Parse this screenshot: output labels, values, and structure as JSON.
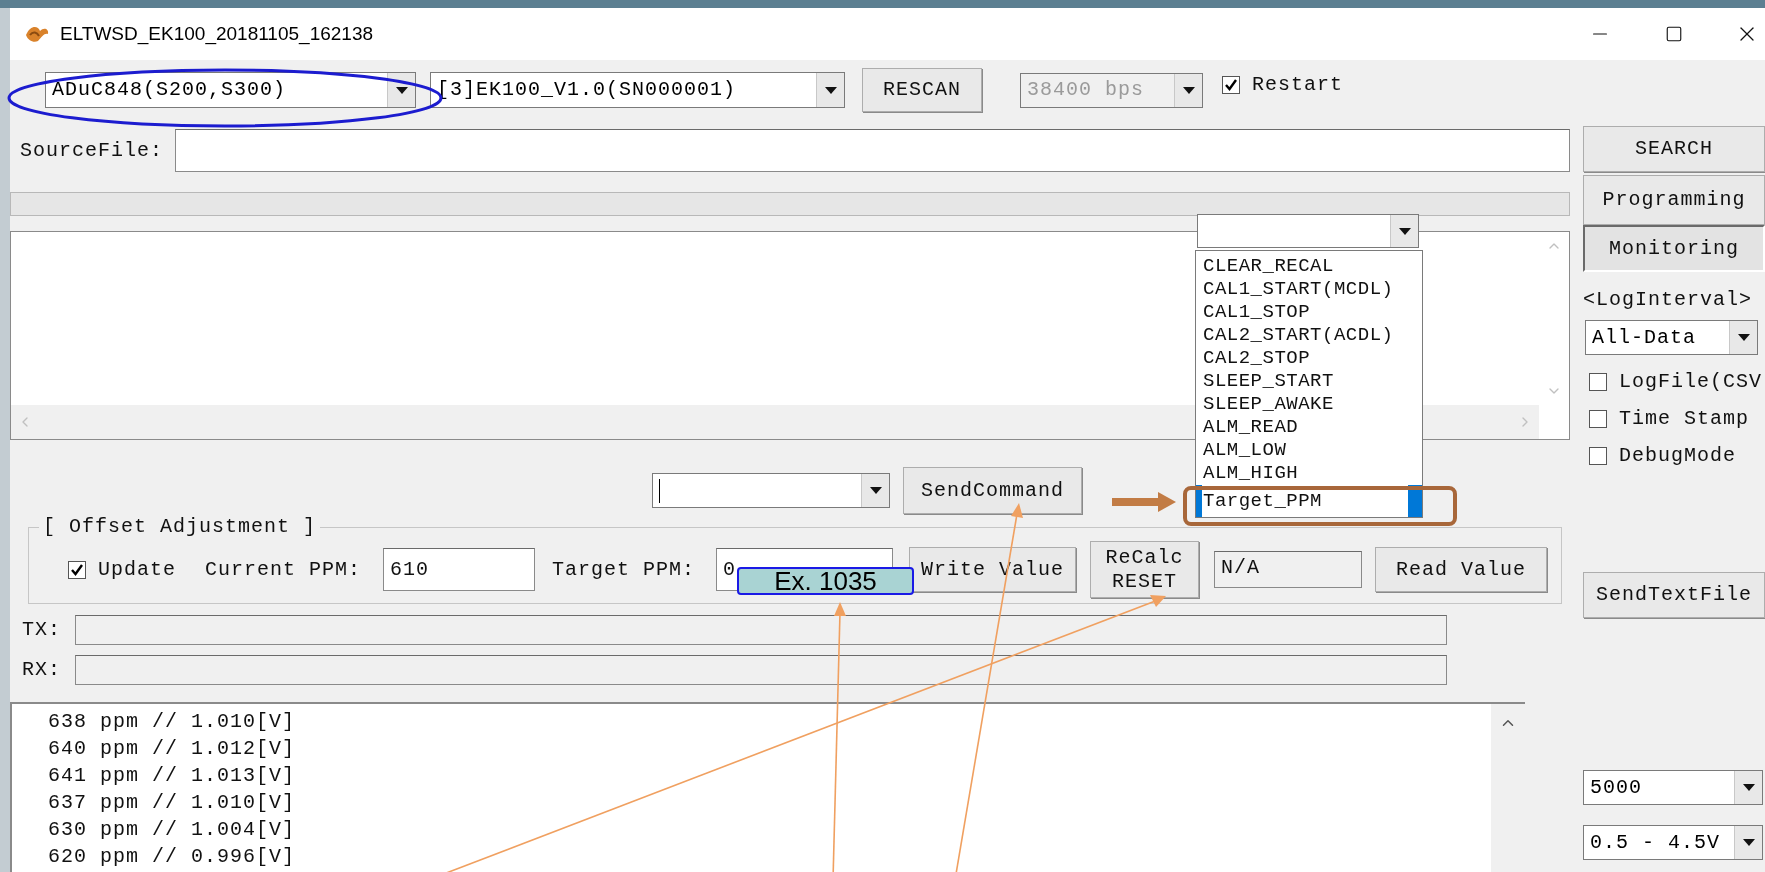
{
  "window": {
    "title": "ELTWSD_EK100_20181105_162138"
  },
  "toolbar": {
    "chip_select": {
      "value": "ADuC848(S200,S300)"
    },
    "device_select": {
      "value": "[3]EK100_V1.0(SN000001)"
    },
    "rescan_button": "RESCAN",
    "baud_select": {
      "value": "38400 bps",
      "disabled": true
    },
    "restart": {
      "label": "Restart",
      "checked": true
    }
  },
  "source_file": {
    "label": "SourceFile:"
  },
  "progress": {
    "level": 0
  },
  "command_menu": {
    "items": [
      {
        "label": "CLEAR_RECAL",
        "selected": false
      },
      {
        "label": "CAL1_START(MCDL)",
        "selected": false
      },
      {
        "label": "CAL1_STOP",
        "selected": false
      },
      {
        "label": "CAL2_START(ACDL)",
        "selected": false
      },
      {
        "label": "CAL2_STOP",
        "selected": false
      },
      {
        "label": "SLEEP_START",
        "selected": false
      },
      {
        "label": "SLEEP_AWAKE",
        "selected": false
      },
      {
        "label": "ALM_READ",
        "selected": false
      },
      {
        "label": "ALM_LOW",
        "selected": false
      },
      {
        "label": "ALM_HIGH",
        "selected": false
      },
      {
        "label": "Target_PPM",
        "selected": true
      }
    ]
  },
  "send_command": {
    "button": "SendCommand"
  },
  "offset": {
    "title": "[ Offset Adjustment ]",
    "update": {
      "label": "Update",
      "checked": true
    },
    "current_label": "Current PPM:",
    "current_value": "610",
    "target_label": "Target PPM:",
    "target_value": "0",
    "write_button": "Write Value",
    "recalc_button": [
      "ReCalc",
      "RESET"
    ],
    "readout": "N/A",
    "read_button": "Read Value"
  },
  "tx": {
    "label": "TX:"
  },
  "rx": {
    "label": "RX:"
  },
  "log_lines": [
    "638 ppm // 1.010[V]",
    "640 ppm // 1.012[V]",
    "641 ppm // 1.013[V]",
    "637 ppm // 1.010[V]",
    "630 ppm // 1.004[V]",
    "620 ppm // 0.996[V]"
  ],
  "side": {
    "buttons": [
      {
        "label": "SEARCH",
        "selected": false
      },
      {
        "label": "Programming",
        "selected": false
      },
      {
        "label": "Monitoring",
        "selected": true
      }
    ],
    "log_interval_label": "<LogInterval>",
    "log_interval": "All-Data",
    "options": [
      {
        "label": "LogFile(CSV",
        "checked": false
      },
      {
        "label": "Time Stamp",
        "checked": false
      },
      {
        "label": "DebugMode",
        "checked": false
      }
    ],
    "send_text_file": "SendTextFile",
    "count_select": "5000",
    "range_select": "0.5 - 4.5V"
  },
  "annotations": {
    "example_label": "Ex. 1035"
  }
}
